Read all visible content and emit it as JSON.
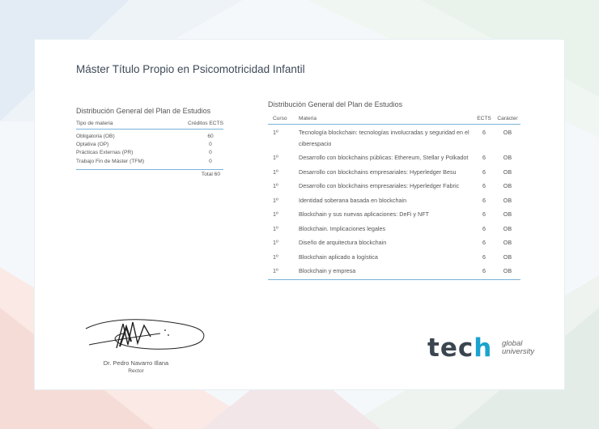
{
  "document": {
    "title": "Máster Título Propio en Psicomotricidad Infantil"
  },
  "left_panel": {
    "title": "Distribución General del Plan de Estudios",
    "header": {
      "type": "Tipo de materia",
      "credits": "Créditos ECTS"
    },
    "rows": [
      {
        "type": "Obligatoria (OB)",
        "credits": "60"
      },
      {
        "type": "Optativa (OP)",
        "credits": "0"
      },
      {
        "type": "Prácticas Externas (PR)",
        "credits": "0"
      },
      {
        "type": "Trabajo Fin de Máster (TFM)",
        "credits": "0"
      }
    ],
    "total": "Total 60"
  },
  "right_panel": {
    "title": "Distribución General del Plan de Estudios",
    "header": {
      "curso": "Curso",
      "materia": "Materia",
      "ects": "ECTS",
      "caracter": "Carácter"
    },
    "rows": [
      {
        "curso": "1º",
        "materia": "Tecnología blockchain: tecnologías involucradas y seguridad en el ciberespacio",
        "ects": "6",
        "caracter": "OB"
      },
      {
        "curso": "1º",
        "materia": "Desarrollo con blockchains públicas: Ethereum, Stellar y Polkadot",
        "ects": "6",
        "caracter": "OB"
      },
      {
        "curso": "1º",
        "materia": "Desarrollo con blockchains empresariales: Hyperledger Besu",
        "ects": "6",
        "caracter": "OB"
      },
      {
        "curso": "1º",
        "materia": "Desarrollo con blockchains empresariales: Hyperledger Fabric",
        "ects": "6",
        "caracter": "OB"
      },
      {
        "curso": "1º",
        "materia": "Identidad soberana basada en blockchain",
        "ects": "6",
        "caracter": "OB"
      },
      {
        "curso": "1º",
        "materia": "Blockchain y sus nuevas aplicaciones: DeFi y NFT",
        "ects": "6",
        "caracter": "OB"
      },
      {
        "curso": "1º",
        "materia": "Blockchain. Implicaciones legales",
        "ects": "6",
        "caracter": "OB"
      },
      {
        "curso": "1º",
        "materia": "Diseño de arquitectura blockchain",
        "ects": "6",
        "caracter": "OB"
      },
      {
        "curso": "1º",
        "materia": "Blockchain aplicado a logística",
        "ects": "6",
        "caracter": "OB"
      },
      {
        "curso": "1º",
        "materia": "Blockchain y empresa",
        "ects": "6",
        "caracter": "OB"
      }
    ]
  },
  "signature": {
    "name": "Dr. Pedro Navarro Illana",
    "role": "Rector"
  },
  "logo": {
    "word": "tech",
    "sub_line1": "global",
    "sub_line2": "university"
  },
  "colors": {
    "accent": "#1aa3cf",
    "rule": "#7ab3d8",
    "text": "#555555"
  }
}
